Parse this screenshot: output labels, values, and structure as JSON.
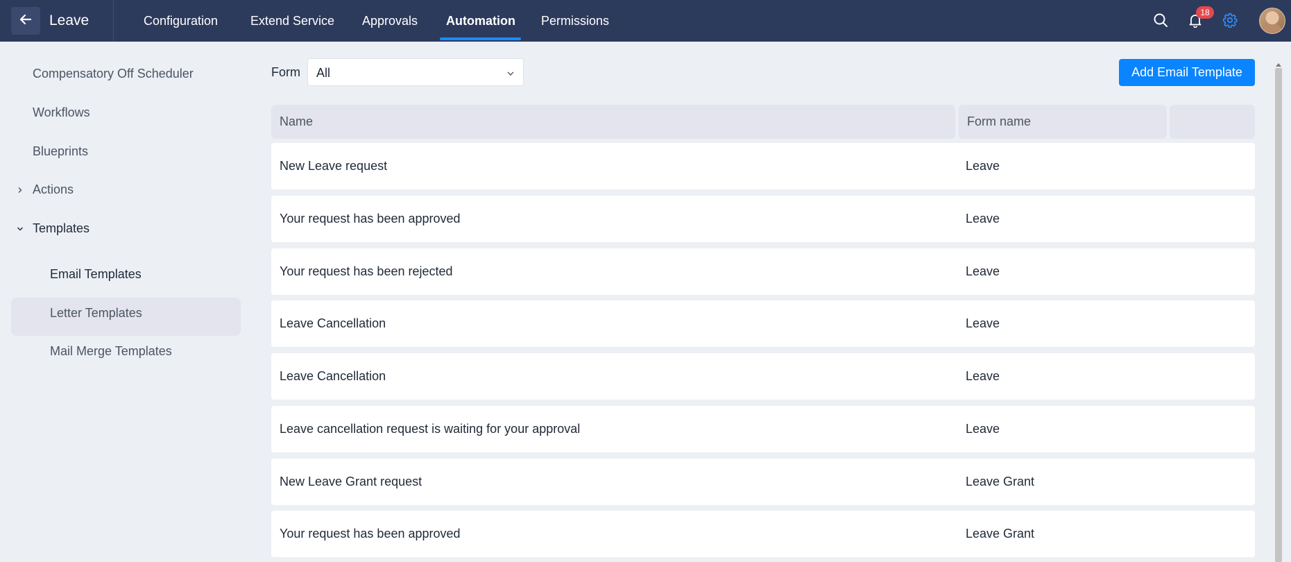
{
  "header": {
    "app_title": "Leave",
    "tabs": [
      {
        "label": "Configuration",
        "active": false
      },
      {
        "label": "Extend Service",
        "active": false
      },
      {
        "label": "Approvals",
        "active": false
      },
      {
        "label": "Automation",
        "active": true
      },
      {
        "label": "Permissions",
        "active": false
      }
    ],
    "notification_count": "18",
    "icons": [
      "back-arrow-icon",
      "search-icon",
      "bell-icon",
      "gear-icon"
    ],
    "colors": {
      "bar": "#2c3a5c",
      "accent": "#1a8cff",
      "badge": "#e5484d",
      "settings_icon": "#2f8cff"
    }
  },
  "sidebar": {
    "items": [
      {
        "label": "Compensatory Off Scheduler"
      },
      {
        "label": "Workflows"
      },
      {
        "label": "Blueprints"
      },
      {
        "label": "Actions",
        "expanded": false
      },
      {
        "label": "Templates",
        "expanded": true
      }
    ],
    "sub_items": [
      {
        "label": "Email Templates",
        "selected": true
      },
      {
        "label": "Letter Templates",
        "selected": false
      },
      {
        "label": "Mail Merge Templates",
        "selected": false
      }
    ]
  },
  "filter": {
    "label": "Form",
    "selected": "All"
  },
  "actions": {
    "add_label": "Add Email Template"
  },
  "table": {
    "columns": [
      "Name",
      "Form name",
      ""
    ],
    "rows": [
      {
        "name": "New Leave request",
        "form": "Leave"
      },
      {
        "name": "Your request has been approved",
        "form": "Leave"
      },
      {
        "name": "Your request has been rejected",
        "form": "Leave"
      },
      {
        "name": "Leave Cancellation",
        "form": "Leave"
      },
      {
        "name": "Leave Cancellation",
        "form": "Leave"
      },
      {
        "name": "Leave cancellation request is waiting for your approval",
        "form": "Leave"
      },
      {
        "name": "New Leave Grant request",
        "form": "Leave Grant"
      },
      {
        "name": "Your request has been approved",
        "form": "Leave Grant"
      }
    ]
  }
}
